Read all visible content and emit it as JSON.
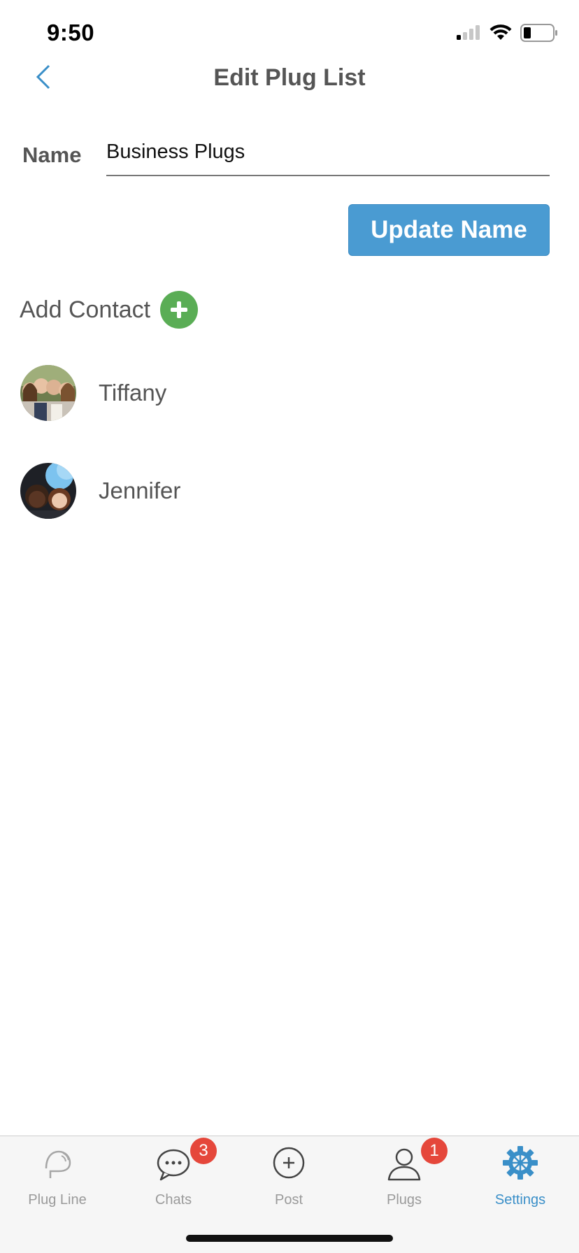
{
  "status_bar": {
    "time": "9:50"
  },
  "nav": {
    "title": "Edit Plug List",
    "back_icon": "chevron-left-icon"
  },
  "form": {
    "name_label": "Name",
    "name_value": "Business Plugs",
    "update_button_label": "Update Name"
  },
  "add_contact": {
    "label": "Add Contact",
    "icon": "plus-circle-icon"
  },
  "contacts": [
    {
      "name": "Tiffany"
    },
    {
      "name": "Jennifer"
    }
  ],
  "tabbar": {
    "tabs": [
      {
        "label": "Plug Line",
        "icon": "plug-line-icon"
      },
      {
        "label": "Chats",
        "icon": "chat-bubble-icon",
        "badge": "3"
      },
      {
        "label": "Post",
        "icon": "plus-circle-outline-icon"
      },
      {
        "label": "Plugs",
        "icon": "person-icon",
        "badge": "1"
      },
      {
        "label": "Settings",
        "icon": "gear-icon",
        "active": true
      }
    ]
  },
  "colors": {
    "accent": "#4a9bd2",
    "add_green": "#5aad55",
    "badge_red": "#e5473b",
    "active_tab": "#3a8fc8"
  }
}
